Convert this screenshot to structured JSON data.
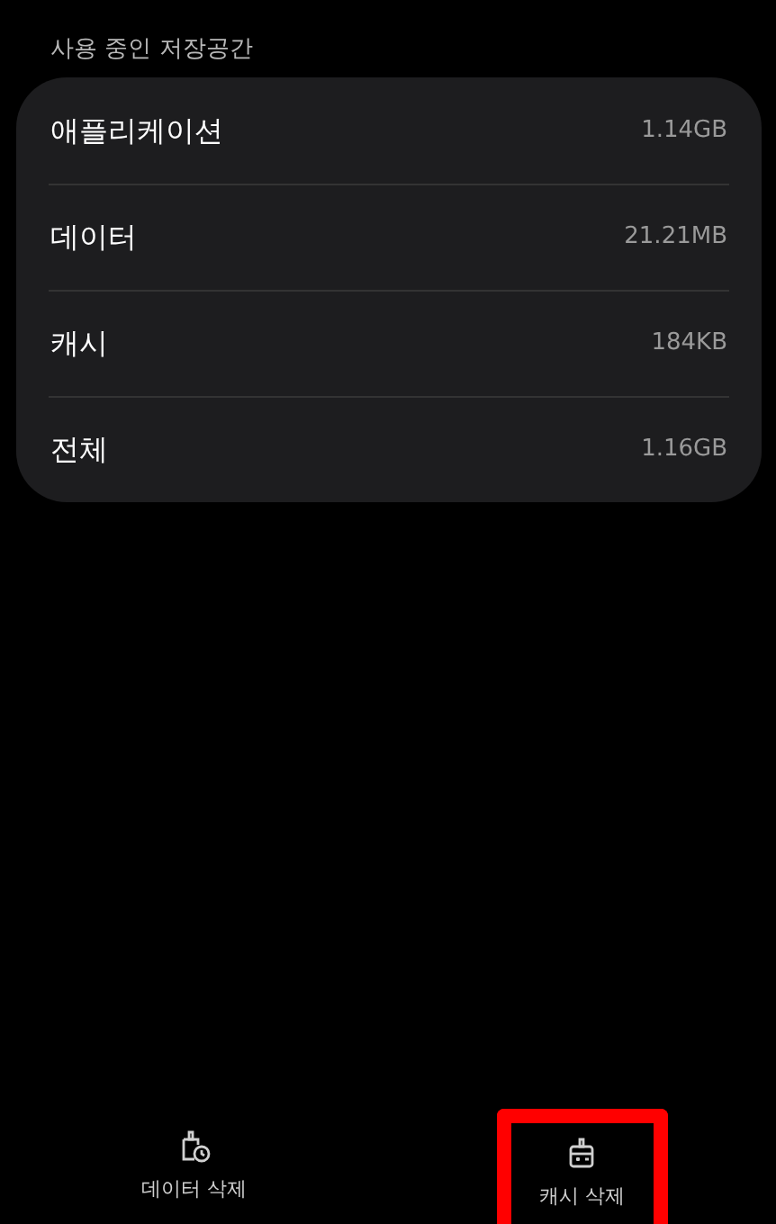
{
  "section_title": "사용 중인 저장공간",
  "rows": [
    {
      "label": "애플리케이션",
      "value": "1.14GB"
    },
    {
      "label": "데이터",
      "value": "21.21MB"
    },
    {
      "label": "캐시",
      "value": "184KB"
    },
    {
      "label": "전체",
      "value": "1.16GB"
    }
  ],
  "actions": [
    {
      "kind": "data",
      "label": "데이터 삭제",
      "highlighted": false
    },
    {
      "kind": "cache",
      "label": "캐시 삭제",
      "highlighted": true
    }
  ]
}
